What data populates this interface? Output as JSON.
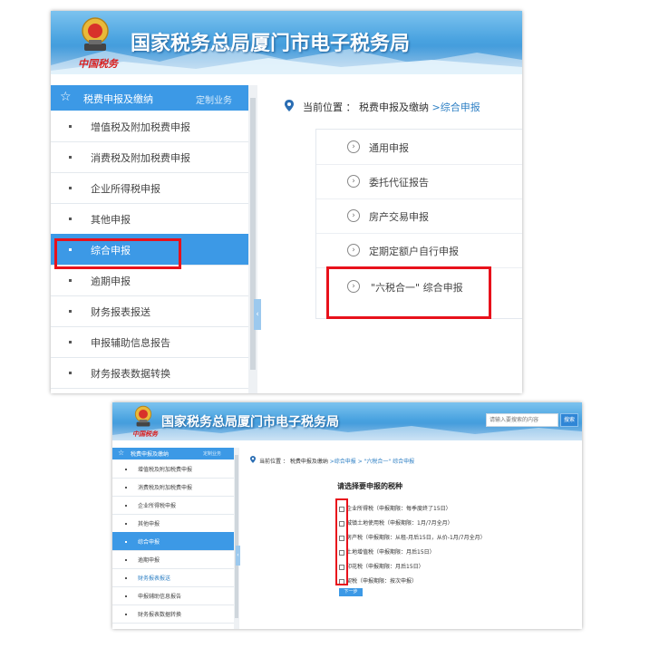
{
  "site_title": "国家税务总局厦门市电子税务局",
  "emblem_caption": "中国税务",
  "sidebar": {
    "header": "税费申报及缴纳",
    "custom": "定制业务",
    "items": [
      {
        "label": "增值税及附加税费申报"
      },
      {
        "label": "消费税及附加税费申报"
      },
      {
        "label": "企业所得税申报"
      },
      {
        "label": "其他申报"
      },
      {
        "label": "综合申报"
      },
      {
        "label": "逾期申报"
      },
      {
        "label": "财务报表报送"
      },
      {
        "label": "申报辅助信息报告"
      },
      {
        "label": "财务报表数据转换"
      }
    ]
  },
  "breadcrumb": {
    "prefix": "当前位置 ：",
    "parent": "税费申报及缴纳",
    "current": ">综合申报",
    "step2_current": ">综合申报 > \"六税合一\" 综合申报"
  },
  "menu_items": [
    {
      "label": "通用申报"
    },
    {
      "label": "委托代征报告"
    },
    {
      "label": "房产交易申报"
    },
    {
      "label": "定期定额户自行申报"
    },
    {
      "label": "\"六税合一\" 综合申报"
    }
  ],
  "search": {
    "placeholder": "请输入要搜索的内容",
    "button": "搜索"
  },
  "tax_choice": {
    "title": "请选择要申报的税种",
    "options": [
      {
        "label": "企业所得税（申报期限：每季度终了15日）"
      },
      {
        "label": "城镇土地使用税（申报期限：1月/7月全月）"
      },
      {
        "label": "房产税（申报期限：从租-月后15日，从价-1月/7月全月）"
      },
      {
        "label": "土地增值税（申报期限：月后15日）"
      },
      {
        "label": "印花税（申报期限：月后15日）"
      },
      {
        "label": "契税（申报期限：按次申报）"
      }
    ],
    "next_button": "下一步"
  },
  "colors": {
    "accent": "#3c99e6",
    "highlight": "#e8111b",
    "link": "#2d7fc4"
  }
}
